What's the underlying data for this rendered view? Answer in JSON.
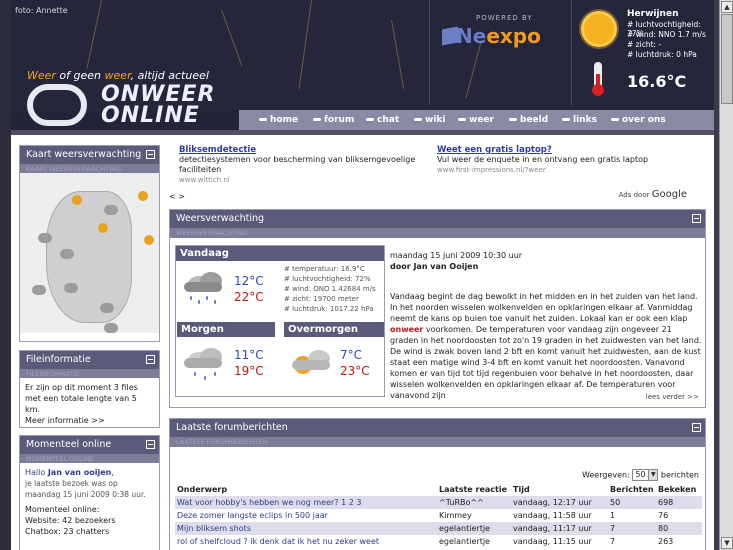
{
  "header": {
    "photo_credit": "foto: Annette",
    "slogan_pre": "Weer",
    "slogan_mid": " of geen ",
    "slogan_em2": "weer",
    "slogan_post": ", altijd actueel",
    "logo_line1": "ONWEER",
    "logo_line2": "ONLINE",
    "powered_by": "POWERED BY",
    "powered_brand_1": "Ne",
    "powered_brand_2": "expo",
    "nav": [
      "home",
      "forum",
      "chat",
      "wiki",
      "weer",
      "beeld",
      "links",
      "over ons"
    ]
  },
  "current_weather": {
    "location": "Herwijnen",
    "humidity": "# luchtvochtigheid: 77%",
    "wind": "# wind: NNO 1.7 m/s",
    "visibility": "# zicht: -",
    "pressure": "# luchtdruk: 0 hPa",
    "temperature": "16.6°C",
    "sun_icon": "sun-icon",
    "thermometer_icon": "thermometer-icon"
  },
  "left": {
    "map_box": {
      "title": "Kaart weersverwachting",
      "sub": "KAART WEERSVERWACHTING"
    },
    "file_box": {
      "title": "Fileinformatie",
      "sub": "FILEINFORMATIE",
      "text": "Er zijn op dit moment 3 files met een totale lengte van 5 km.",
      "more": "Meer informatie >>"
    },
    "online_box": {
      "title": "Momenteel online",
      "sub": "MOMENTEEL ONLINE",
      "greeting_pre": "Hallo ",
      "greeting_name": "Jan van ooijen",
      "greeting_post": ",",
      "last_visit": "je laatste bezoek was op maandag 15 juni 2009 0:38 uur.",
      "label": "Momenteel online:",
      "website": "Website: 42 bezoekers",
      "chatbox": "Chatbox: 23 chatters"
    }
  },
  "ads": [
    {
      "title": "Bliksemdetectie",
      "desc": "detectiesystemen voor bescherming van bliksemgevoelige faciliteiten",
      "url": "www.wittich.nl"
    },
    {
      "title": "Weet een gratis laptop?",
      "desc": "Vul weer de enquete in en ontvang een gratis laptop",
      "url": "www.first-impressions.nl/?weer"
    }
  ],
  "ads_nav": "< >",
  "ads_by_label": "Ads door",
  "ads_by_brand": "Google",
  "forecast": {
    "title": "Weersverwachting",
    "sub": "WEERSVERWACHTING",
    "today": {
      "label": "Vandaag",
      "tmin": "12°C",
      "tmax": "22°C",
      "details": [
        "# temperatuur: 16.9°C",
        "# luchtvochtigheid: 72%",
        "# wind: ONO 1.42684 m/s",
        "# zicht: 19700 meter",
        "# luchtdruk: 1017.22 hPa"
      ]
    },
    "tomorrow": {
      "label": "Morgen",
      "tmin": "11°C",
      "tmax": "19°C"
    },
    "day_after": {
      "label": "Overmorgen",
      "tmin": "7°C",
      "tmax": "23°C"
    },
    "article": {
      "date": "maandag 15 juni 2009 10:30 uur",
      "author": "door Jan van Ooijen",
      "body_1": "Vandaag begint de dag bewolkt in het midden en in het zuiden van het land. In het noorden wisselen wolkenvelden en opklaringen elkaar af. Vanmiddag neemt de kans op buien toe vanuit het zuiden. Lokaal kan er ook een klap ",
      "highlight": "onweer",
      "body_2": " voorkomen. De temperaturen voor vandaag zijn ongeveer 21 graden in het noordoosten tot zo'n 19 graden in het zuidwesten van het land. De wind is zwak boven land 2 bft en komt vanuit het zuidwesten, aan de kust staat een matige wind 3-4 bft en komt vanuit het noordoosten. Vanavond komen er van tijd tot tijd regenbuien voor behalve in het noordoosten, daar wisselen wolkenvelden en opklaringen elkaar af. De temperaturen voor vanavond zijn",
      "more": "lees verder >>"
    }
  },
  "forum": {
    "title": "Laatste forumberichten",
    "sub": "LAATSTE FORUMBERICHTEN",
    "show_label": "Weergeven:",
    "show_value": "50",
    "show_suffix": "berichten",
    "columns": [
      "Onderwerp",
      "Laatste reactie",
      "Tijd",
      "Berichten",
      "Bekeken"
    ],
    "rows": [
      [
        "Wat voor hobby's hebben we nog meer?  1 2 3",
        "^TuRBo^^",
        "vandaag, 12:17 uur",
        "50",
        "698"
      ],
      [
        "Deze zomer langste eclips in 500 jaar",
        "Kimmey",
        "vandaag, 11:58 uur",
        "1",
        "76"
      ],
      [
        "Mijn bliksem shots",
        "egelantiertje",
        "vandaag, 11:17 uur",
        "7",
        "80"
      ],
      [
        "rol of shelfcloud ? ik denk dat ik het nu zeker weet",
        "egelantiertje",
        "vandaag, 11:15 uur",
        "7",
        "263"
      ]
    ]
  }
}
